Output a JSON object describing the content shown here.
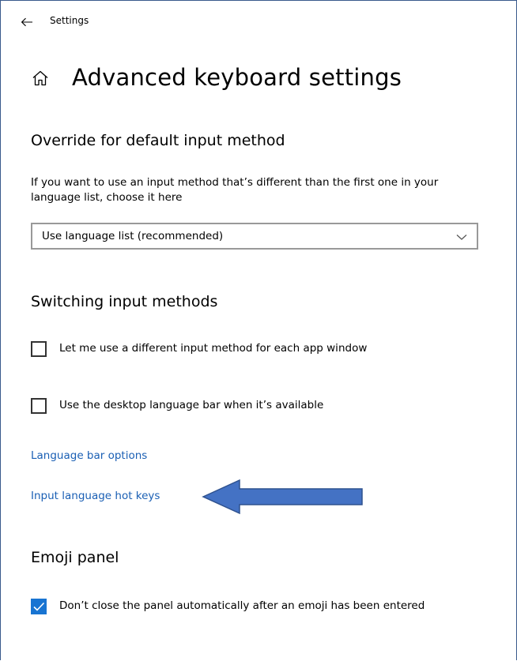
{
  "window": {
    "title": "Settings",
    "back_icon": "back-arrow-icon"
  },
  "page": {
    "home_icon": "home-icon",
    "title": "Advanced keyboard settings"
  },
  "override_section": {
    "heading": "Override for default input method",
    "description": "If you want to use an input method that’s different than the first one in your language list, choose it here",
    "dropdown": {
      "selected": "Use language list (recommended)",
      "chevron_icon": "chevron-down-icon"
    }
  },
  "switching_section": {
    "heading": "Switching input methods",
    "checkboxes": [
      {
        "label": "Let me use a different input method for each app window",
        "checked": false
      },
      {
        "label": "Use the desktop language bar when it’s available",
        "checked": false
      }
    ],
    "links": [
      {
        "label": "Language bar options"
      },
      {
        "label": "Input language hot keys"
      }
    ]
  },
  "emoji_section": {
    "heading": "Emoji panel",
    "checkboxes": [
      {
        "label": "Don’t close the panel automatically after an emoji has been entered",
        "checked": true
      }
    ]
  },
  "colors": {
    "link": "#1a5fb4",
    "checkbox_checked": "#1874d2",
    "annotation_arrow": "#4472c4",
    "annotation_arrow_border": "#2f528f"
  },
  "annotation": {
    "icon": "left-arrow-annotation-icon"
  }
}
